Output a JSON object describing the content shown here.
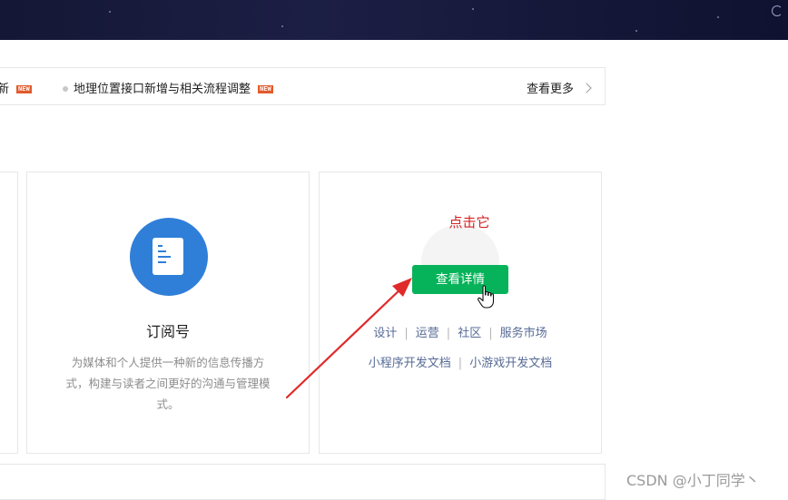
{
  "notice": {
    "item1": "新",
    "item2": "地理位置接口新增与相关流程调整",
    "new_badge": "NEW",
    "more_label": "查看更多"
  },
  "subscription": {
    "title": "订阅号",
    "description": "为媒体和个人提供一种新的信息传播方式，构建与读者之间更好的沟通与管理模式。"
  },
  "miniprogram": {
    "click_hint": "点击它",
    "detail_button": "查看详情",
    "links_row1": [
      "设计",
      "运营",
      "社区",
      "服务市场"
    ],
    "links_row2": [
      "小程序开发文档",
      "小游戏开发文档"
    ]
  },
  "watermark": "CSDN @小丁同学丶",
  "colors": {
    "accent_green": "#07b35a",
    "annotation_red": "#d42424",
    "subscription_blue": "#2f7fd9",
    "link_blue": "#576b95"
  }
}
